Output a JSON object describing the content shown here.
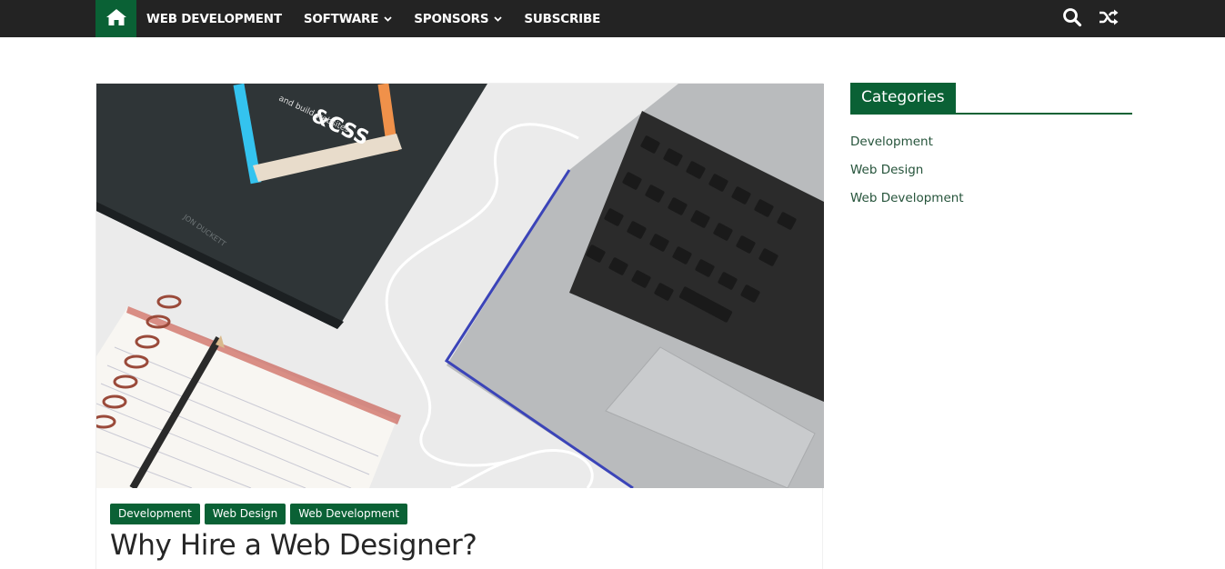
{
  "nav": {
    "home_icon": "home-icon",
    "items": [
      {
        "label": "WEB DEVELOPMENT",
        "has_dropdown": false
      },
      {
        "label": "SOFTWARE",
        "has_dropdown": true
      },
      {
        "label": "SPONSORS",
        "has_dropdown": true
      },
      {
        "label": "SUBSCRIBE",
        "has_dropdown": false
      }
    ],
    "tools": [
      "search-icon",
      "shuffle-icon"
    ]
  },
  "article": {
    "hero_image": "laptop-and-book-illustration",
    "hero_visible_text": {
      "book_title": "&CSS",
      "book_subtitle": "and build websites",
      "book_author": "JON DUCKETT"
    },
    "categories": [
      "Development",
      "Web Design",
      "Web Development"
    ],
    "title": "Why Hire a Web Designer?"
  },
  "sidebar": {
    "widget_title": "Categories",
    "categories": [
      "Development",
      "Web Design",
      "Web Development"
    ]
  },
  "colors": {
    "accent": "#0a6135",
    "topbar": "#232323",
    "link": "#25533a"
  }
}
